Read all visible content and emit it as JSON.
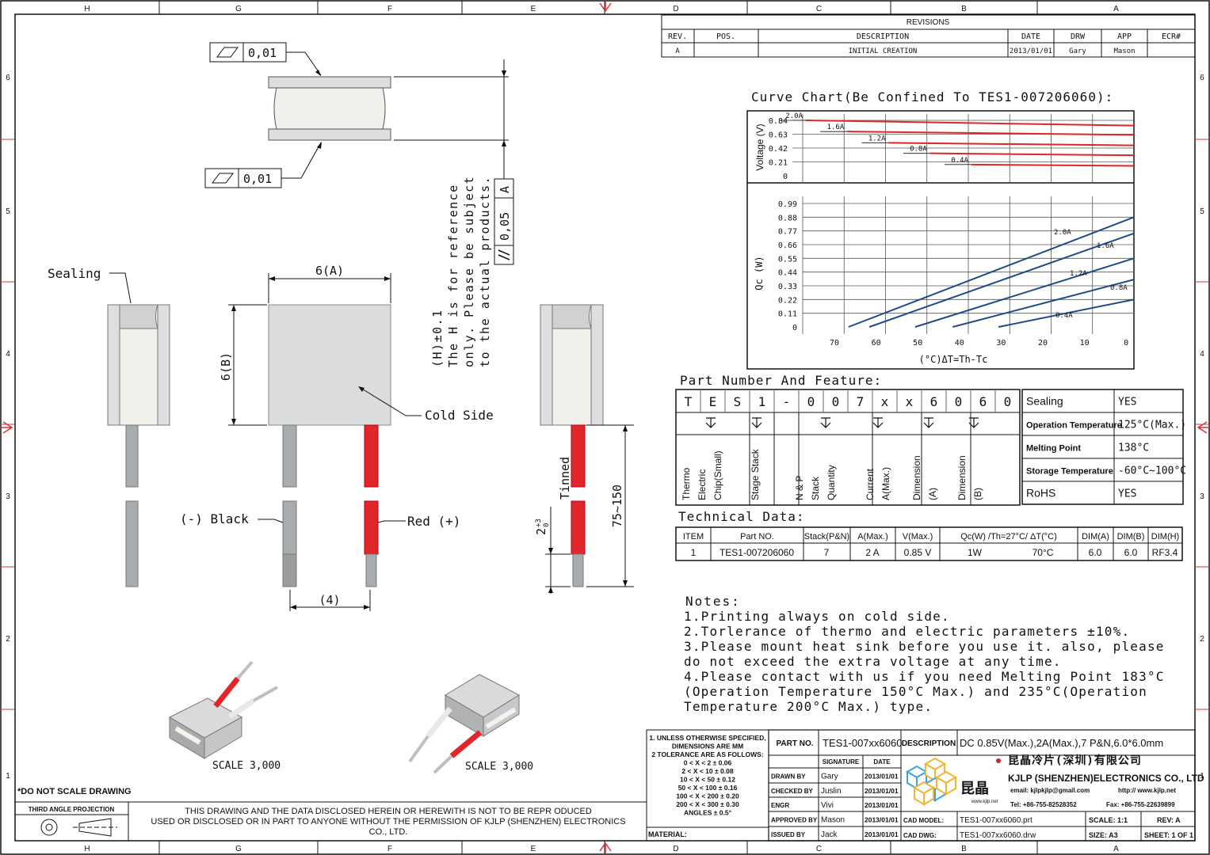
{
  "border": {
    "columns": [
      "H",
      "G",
      "F",
      "E",
      "D",
      "C",
      "B",
      "A"
    ],
    "rows": [
      "6",
      "5",
      "4",
      "3",
      "2",
      "1"
    ]
  },
  "revisions": {
    "title": "REVISIONS",
    "headers": [
      "REV.",
      "POS.",
      "DESCRIPTION",
      "DATE",
      "DRW",
      "APP",
      "ECR#"
    ],
    "row": [
      "A",
      "",
      "INITIAL CREATION",
      "2013/01/01",
      "Gary",
      "Mason",
      ""
    ]
  },
  "drawing": {
    "flatness_1": "0,01",
    "flatness_2": "0,01",
    "parallel_tol": "0,05",
    "parallel_datum": "A",
    "h_note": [
      "(H)±0.1",
      "The H is for reference",
      "only. Please be subject",
      "to the actual products."
    ],
    "dim_a": "6(A)",
    "dim_b": "6(B)",
    "dim_4": "(4)",
    "sealing": "Sealing",
    "cold_side": "Cold Side",
    "black": "(-) Black",
    "red": "Red (+)",
    "tinned": "Tinned",
    "tin_len": "2",
    "tin_sup": "+3",
    "tin_sub": "0",
    "lead_len": "75~150",
    "scale1": "SCALE   3,000",
    "scale2": "SCALE   3,000"
  },
  "chart_title": "Curve Chart(Be Confined To TES1-007206060):",
  "chart_data": [
    {
      "type": "line",
      "ylabel": "Voltage (V)",
      "ytick_labels": [
        "0.84",
        "0.63",
        "0.42",
        "0.21",
        "0"
      ],
      "series": [
        {
          "name": "2.0A",
          "x": [
            70,
            0
          ],
          "y": [
            0.84,
            0.76
          ]
        },
        {
          "name": "1.6A",
          "x": [
            60,
            0
          ],
          "y": [
            0.67,
            0.62
          ]
        },
        {
          "name": "1.2A",
          "x": [
            50,
            0
          ],
          "y": [
            0.5,
            0.46
          ]
        },
        {
          "name": "0.8A",
          "x": [
            40,
            0
          ],
          "y": [
            0.34,
            0.31
          ]
        },
        {
          "name": "0.4A",
          "x": [
            30,
            0
          ],
          "y": [
            0.17,
            0.15
          ]
        }
      ]
    },
    {
      "type": "line",
      "ylabel": "Qc  (W)",
      "xlabel": "(°C)ΔT=Th-Tc",
      "xtick_labels": [
        "70",
        "60",
        "50",
        "40",
        "30",
        "20",
        "10",
        "0"
      ],
      "ytick_labels": [
        "0.99",
        "0.88",
        "0.77",
        "0.66",
        "0.55",
        "0.44",
        "0.33",
        "0.22",
        "0.11",
        "0"
      ],
      "series": [
        {
          "name": "2.0A",
          "x": [
            67,
            0
          ],
          "y": [
            0,
            0.88
          ]
        },
        {
          "name": "1.6A",
          "x": [
            62,
            0
          ],
          "y": [
            0,
            0.75
          ]
        },
        {
          "name": "1.2A",
          "x": [
            51,
            0
          ],
          "y": [
            0,
            0.55
          ]
        },
        {
          "name": "0.8A",
          "x": [
            42,
            0
          ],
          "y": [
            0,
            0.38
          ]
        },
        {
          "name": "0.4A",
          "x": [
            31,
            0
          ],
          "y": [
            0,
            0.22
          ]
        }
      ]
    }
  ],
  "part_number": {
    "title": "Part Number And Feature:",
    "chars": [
      "T",
      "E",
      "S",
      "1",
      "-",
      "0",
      "0",
      "7",
      "x",
      "x",
      "6",
      "0",
      "6",
      "0"
    ],
    "descriptions": [
      "Thermo Electric Chip(Small)",
      "Stage Stack",
      "N & P Stack Quantity",
      "Current A(Max.)",
      "Dimension (A)",
      "Dimension (B)"
    ]
  },
  "features": [
    {
      "k": "Sealing",
      "v": "YES"
    },
    {
      "k": "Operation Temperature",
      "v": "125°C(Max.)"
    },
    {
      "k": "Melting Point",
      "v": "138°C"
    },
    {
      "k": "Storage Temperature",
      "v": "-60°C~100°C"
    },
    {
      "k": "RoHS",
      "v": "YES"
    }
  ],
  "technical": {
    "title": "Technical Data:",
    "headers": [
      "ITEM",
      "Part NO.",
      "Stack(P&N)",
      "A(Max.)",
      "V(Max.)",
      "Qc(W) /Th=27°C/ ΔT(°C)",
      "DIM(A)",
      "DIM(B)",
      "DIM(H)"
    ],
    "row": [
      "1",
      "TES1-007206060",
      "7",
      "2 A",
      "0.85 V",
      "1W",
      "70°C",
      "6.0",
      "6.0",
      "RF3.4"
    ]
  },
  "notes": {
    "title": "Notes:",
    "lines": [
      "1.Printing always on cold side.",
      "2.Torlerance of thermo and electric parameters ±10%.",
      "3.Please mount heat sink before you use it. also, please",
      "  do not exceed the extra voltage at any time.",
      "4.Please contact with us if you need Melting Point 183°C",
      "  (Operation Temperature 150°C Max.) and 235°C(Operation",
      "  Temperature 200°C Max.) type."
    ]
  },
  "title_block": {
    "tolerance": [
      "1. UNLESS OTHERWISE SPECIFIED,",
      "DIMENSIONS ARE MM",
      "2 TOLERANCE ARE AS FOLLOWS:",
      "0 < X <   2  ± 0.06",
      "2 < X <  10  ± 0.08",
      "10 < X <  50  ± 0.12",
      "50 < X < 100  ± 0.16",
      "100 < X < 200  ± 0.20",
      "200 < X < 300  ± 0.30",
      "ANGLES ± 0.5°"
    ],
    "part_no_label": "PART NO.",
    "part_no": "TES1-007xx6060",
    "desc_label": "DESCRIPTION",
    "desc": "DC 0.85V(Max.),2A(Max.),7 P&N,6.0*6.0mm",
    "sig_label": "SIGNATURE",
    "date_label": "DATE",
    "people": [
      {
        "role": "DRAWN BY",
        "name": "Gary",
        "date": "2013/01/01"
      },
      {
        "role": "CHECKED BY",
        "name": "Juslin",
        "date": "2013/01/01"
      },
      {
        "role": "ENGR",
        "name": "Vivi",
        "date": "2013/01/01"
      },
      {
        "role": "APPROVED BY",
        "name": "Mason",
        "date": "2013/01/01"
      },
      {
        "role": "ISSUED BY",
        "name": "Jack",
        "date": "2013/01/01"
      }
    ],
    "company_cn": "昆晶冷片(深圳)有限公司",
    "company_en": "KJLP (SHENZHEN)ELECTRONICS CO., LTD",
    "email": "email: kjlpkjlp@gmail.com",
    "web": "http:// www.kjlp.net",
    "tel": "Tel: +86-755-82528352",
    "fax": "Fax: +86-755-22639899",
    "logo_text": "昆晶",
    "logo_url": "www.kjlp.net",
    "cad_model_label": "CAD MODEL:",
    "cad_model": "TES1-007xx6060.prt",
    "cad_dwg_label": "CAD DWG:",
    "cad_dwg": "TES1-007xx6060.drw",
    "scale": "SCALE: 1:1",
    "size": "SIZE: A3",
    "rev": "REV: A",
    "sheet": "SHEET: 1 OF 1",
    "material": "MATERIAL:",
    "no_scale": "*DO NOT SCALE DRAWING",
    "projection": "THIRD ANGLE PROJECTION",
    "disclaimer": [
      "THIS DRAWING AND THE DATA DISCLOSED HEREIN OR HEREWITH IS NOT TO BE REPR ODUCED",
      "USED OR DISCLOSED OR IN PART TO ANYONE WITHOUT THE PERMISSION OF KJLP (SHENZHEN) ELECTRONICS",
      "CO., LTD."
    ]
  },
  "colors": {
    "red": "#e0262a",
    "gray": "#b0b3b6",
    "panel": "#dadcdd",
    "line": "#111111"
  }
}
